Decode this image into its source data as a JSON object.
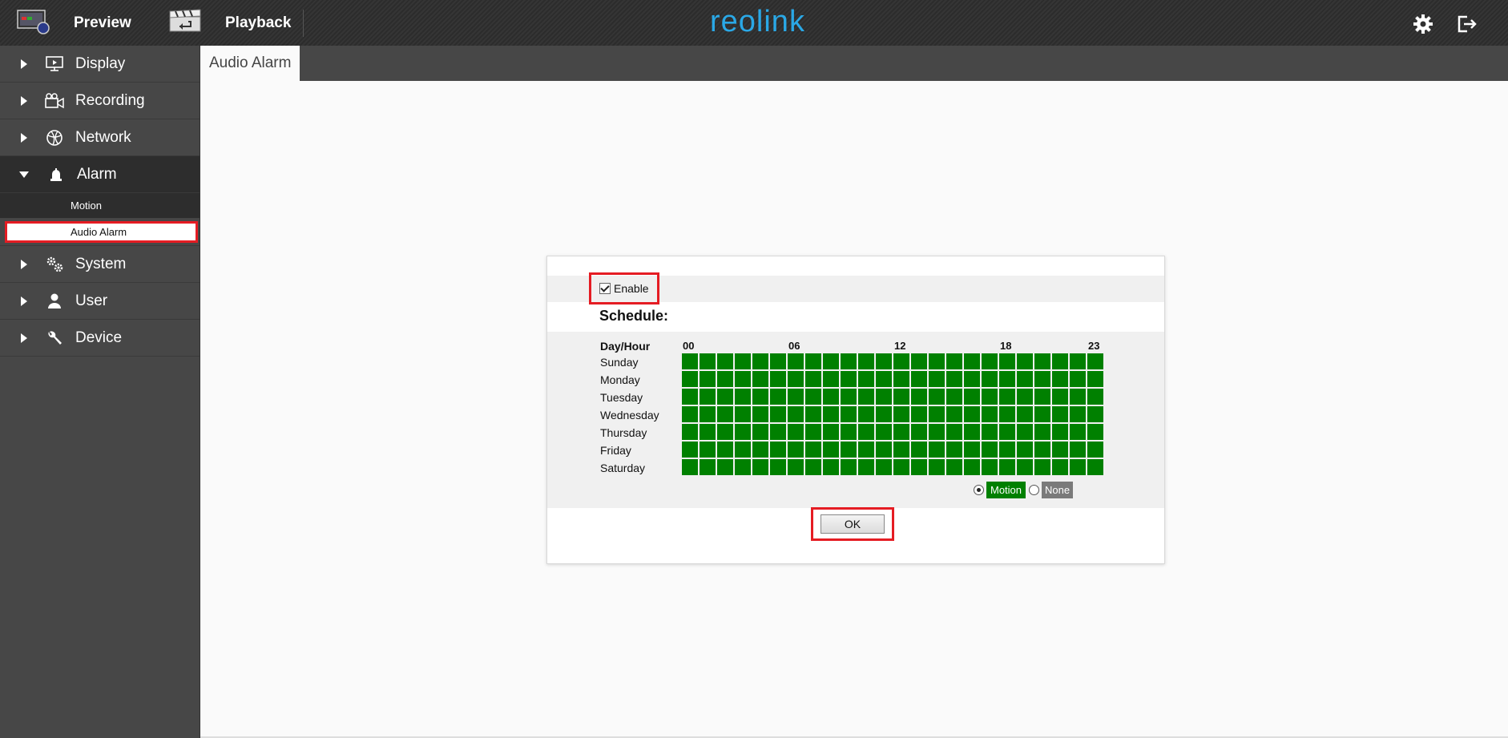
{
  "topbar": {
    "preview_label": "Preview",
    "playback_label": "Playback",
    "logo_text": "reolink",
    "settings_icon": "gear-icon",
    "logout_icon": "logout-icon"
  },
  "sidebar": {
    "items": [
      {
        "label": "Display",
        "icon": "monitor-icon"
      },
      {
        "label": "Recording",
        "icon": "camera-icon"
      },
      {
        "label": "Network",
        "icon": "globe-icon"
      },
      {
        "label": "Alarm",
        "icon": "siren-icon",
        "open": true,
        "children": [
          {
            "label": "Motion"
          },
          {
            "label": "Audio Alarm",
            "active": true
          }
        ]
      },
      {
        "label": "System",
        "icon": "gears-icon"
      },
      {
        "label": "User",
        "icon": "user-icon"
      },
      {
        "label": "Device",
        "icon": "wrench-icon"
      }
    ]
  },
  "tab": {
    "label": "Audio Alarm"
  },
  "panel": {
    "enable_label": "Enable",
    "enable_checked": true,
    "schedule_title": "Schedule:",
    "day_hour_label": "Day/Hour",
    "hour_markers": [
      "00",
      "06",
      "12",
      "18",
      "23"
    ],
    "days": [
      "Sunday",
      "Monday",
      "Tuesday",
      "Wednesday",
      "Thursday",
      "Friday",
      "Saturday"
    ],
    "hours_per_day": 24,
    "all_cells": "motion",
    "legend": {
      "motion_label": "Motion",
      "none_label": "None",
      "selected": "motion"
    },
    "ok_label": "OK"
  },
  "colors": {
    "motion": "#008000",
    "none": "#7a7a7a",
    "accent": "#2aa8e6",
    "highlight": "#e51c23"
  }
}
